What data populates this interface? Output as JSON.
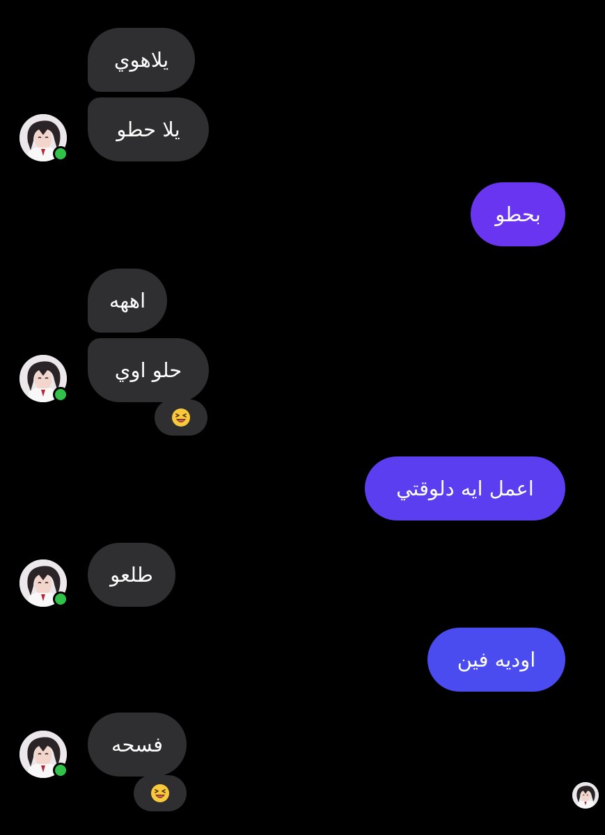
{
  "colors": {
    "background": "#000000",
    "incoming_bubble": "#2f2f31",
    "outgoing_bubble_1": "#6a35f0",
    "outgoing_bubble_2": "#5a3ef0",
    "outgoing_bubble_3": "#4a4cef",
    "online_indicator": "#31c24a"
  },
  "messages": [
    {
      "id": "m1",
      "side": "incoming",
      "text": "يلاهوي"
    },
    {
      "id": "m2",
      "side": "incoming",
      "text": "يلا حطو"
    },
    {
      "id": "m3",
      "side": "outgoing",
      "text": "بحطو"
    },
    {
      "id": "m4",
      "side": "incoming",
      "text": "اههه"
    },
    {
      "id": "m5",
      "side": "incoming",
      "text": "حلو اوي",
      "reaction": "laughing-emoji-icon"
    },
    {
      "id": "m6",
      "side": "outgoing",
      "text": "اعمل ايه دلوقتي"
    },
    {
      "id": "m7",
      "side": "incoming",
      "text": "طلعو"
    },
    {
      "id": "m8",
      "side": "outgoing",
      "text": "اوديه فين"
    },
    {
      "id": "m9",
      "side": "incoming",
      "text": "فسحه",
      "reaction": "laughing-emoji-icon"
    }
  ],
  "icons": {
    "contact_avatar": "anime-avatar-icon",
    "online_status": "online-dot-icon",
    "seen_receipt": "seen-avatar-icon"
  }
}
